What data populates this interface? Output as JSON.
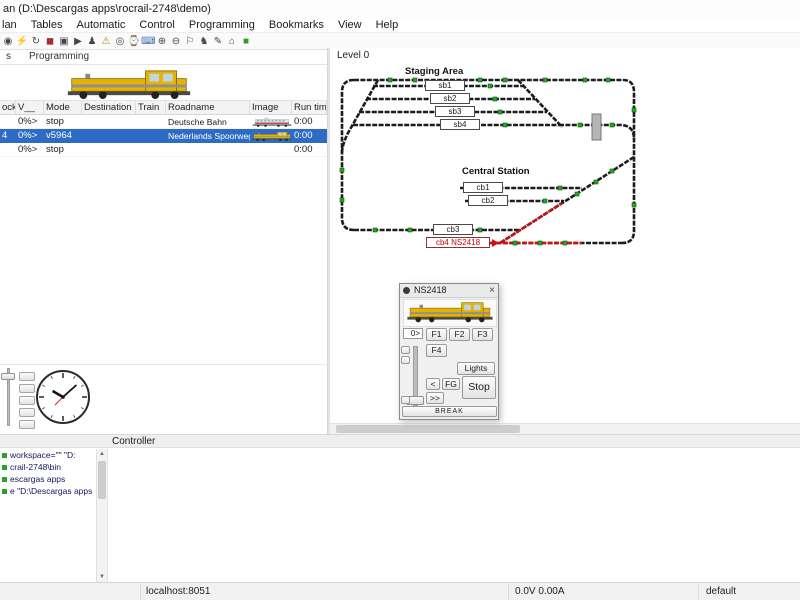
{
  "window": {
    "title": "an (D:\\Descargas apps\\rocrail-2748\\demo)"
  },
  "menu": {
    "items": [
      "lan",
      "Tables",
      "Automatic",
      "Control",
      "Programming",
      "Bookmarks",
      "View",
      "Help"
    ]
  },
  "toolbar": {
    "icons": [
      {
        "name": "power-icon",
        "glyph": "◉"
      },
      {
        "name": "plug-icon",
        "glyph": "⚡"
      },
      {
        "name": "reset-icon",
        "glyph": "↻"
      },
      {
        "name": "stop-icon",
        "glyph": "◼"
      },
      {
        "name": "emergency-break-icon",
        "glyph": "▣"
      },
      {
        "name": "auto-mode-icon",
        "glyph": "▶"
      },
      {
        "name": "loco-icon",
        "glyph": "♟"
      },
      {
        "name": "warning-icon",
        "glyph": "⚠"
      },
      {
        "name": "trace-icon",
        "glyph": "◎"
      },
      {
        "name": "clock-icon",
        "glyph": "⌚"
      },
      {
        "name": "monitor-icon",
        "glyph": "⌨"
      },
      {
        "name": "zoom-in-icon",
        "glyph": "⊕"
      },
      {
        "name": "zoom-out-icon",
        "glyph": "⊖"
      },
      {
        "name": "flag-icon",
        "glyph": "⚐"
      },
      {
        "name": "knight-icon",
        "glyph": "♞"
      },
      {
        "name": "notes-icon",
        "glyph": "✎"
      },
      {
        "name": "folder-icon",
        "glyph": "⌂"
      },
      {
        "name": "go-icon",
        "glyph": "■"
      }
    ]
  },
  "tabs": {
    "left_tab": "s",
    "programming_tab": "Programming"
  },
  "loco_table": {
    "columns": [
      "ock",
      "V__",
      "Mode",
      "Destination",
      "Train",
      "Roadname",
      "Image",
      "Run time"
    ],
    "rows": [
      {
        "block": "",
        "v": "0%>",
        "mode": "stop",
        "destination": "",
        "train": "",
        "roadname": "Deutsche Bahn",
        "runtime": "0:00"
      },
      {
        "block": "4",
        "v": "0%>",
        "mode": "v5964",
        "destination": "",
        "train": "",
        "roadname": "Nederlands Spoorwegen",
        "runtime": "0:00"
      },
      {
        "block": "",
        "v": "0%>",
        "mode": "stop",
        "destination": "",
        "train": "",
        "roadname": "",
        "runtime": "0:00"
      }
    ]
  },
  "plan": {
    "level_label": "Level 0",
    "staging_label": "Staging Area",
    "central_label": "Central Station",
    "blocks": {
      "sb1": "sb1",
      "sb2": "sb2",
      "sb3": "sb3",
      "sb4": "sb4",
      "cb1": "cb1",
      "cb2": "cb2",
      "cb3": "cb3",
      "cb4": "cb4 NS2418"
    },
    "colors": {
      "track": "#1c1c1c",
      "occupied": "#cc1111",
      "sensor": "#22aa22"
    }
  },
  "throttle": {
    "title": "NS2418",
    "speed_display": "0>",
    "f1": "F1",
    "f2": "F2",
    "f3": "F3",
    "f4": "F4",
    "lights": "Lights",
    "prev": "<",
    "fg": "FG",
    "next": ">>",
    "stop": "Stop",
    "break": "BREAK",
    "close": "×"
  },
  "controller": {
    "title": "Controller",
    "log": [
      "workspace=\"\" \"D:",
      "crail-2748\\bin",
      "escargas apps",
      "e \"D:\\Descargas apps"
    ]
  },
  "statusbar": {
    "host": "localhost:8051",
    "power": "0.0V 0.00A",
    "profile": "default"
  }
}
